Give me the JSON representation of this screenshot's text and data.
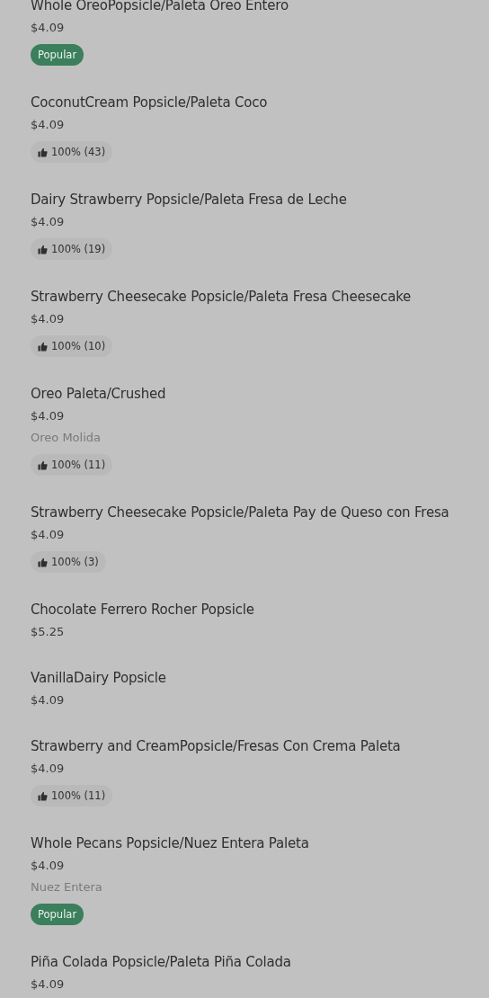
{
  "menu_items": [
    {
      "title": "Whole OreoPopsicle/Paleta Oreo Entero",
      "price": "$4.09",
      "badge": {
        "kind": "popular",
        "label": "Popular"
      }
    },
    {
      "title": "CoconutCream Popsicle/Paleta Coco",
      "price": "$4.09",
      "badge": {
        "kind": "rating",
        "label": "100% (43)"
      }
    },
    {
      "title": "Dairy Strawberry Popsicle/Paleta Fresa de Leche",
      "price": "$4.09",
      "badge": {
        "kind": "rating",
        "label": "100% (19)"
      }
    },
    {
      "title": "Strawberry Cheesecake Popsicle/Paleta Fresa Cheesecake",
      "price": "$4.09",
      "badge": {
        "kind": "rating",
        "label": "100% (10)"
      }
    },
    {
      "title": "Oreo Paleta/Crushed",
      "price": "$4.09",
      "description": "Oreo Molida",
      "badge": {
        "kind": "rating",
        "label": "100% (11)"
      }
    },
    {
      "title": "Strawberry Cheesecake Popsicle/Paleta Pay de Queso con Fresa",
      "price": "$4.09",
      "badge": {
        "kind": "rating",
        "label": "100% (3)"
      }
    },
    {
      "title": "Chocolate Ferrero Rocher Popsicle",
      "price": "$5.25"
    },
    {
      "title": "VanillaDairy Popsicle",
      "price": "$4.09"
    },
    {
      "title": "Strawberry and CreamPopsicle/Fresas Con Crema Paleta",
      "price": "$4.09",
      "badge": {
        "kind": "rating",
        "label": "100% (11)"
      }
    },
    {
      "title": "Whole Pecans Popsicle/Nuez Entera Paleta",
      "price": "$4.09",
      "description": "Nuez Entera",
      "badge": {
        "kind": "popular",
        "label": "Popular"
      }
    },
    {
      "title": "Piña Colada Popsicle/Paleta Piña Colada",
      "price": "$4.09"
    }
  ]
}
